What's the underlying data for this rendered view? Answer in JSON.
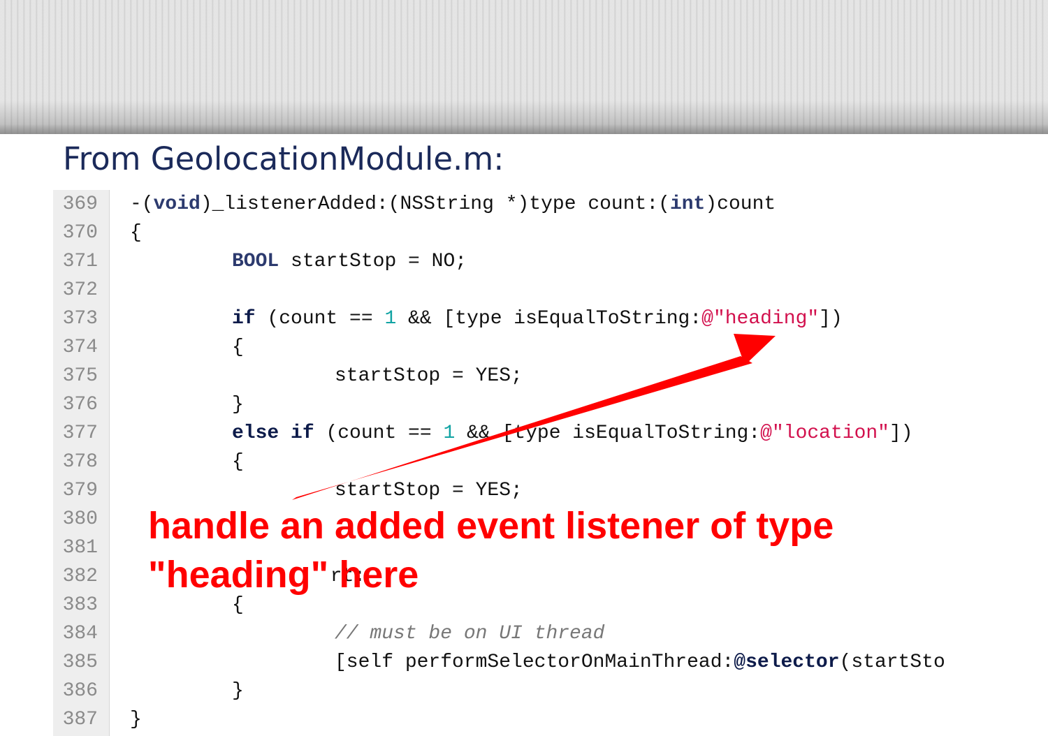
{
  "slide": {
    "title": "From GeolocationModule.m:",
    "annotation_line1": "handle an added event listener of type",
    "annotation_line2": "\"heading\" here",
    "annotation_color": "#ff0000",
    "title_color": "#1b2a5a"
  },
  "code": {
    "lines": [
      {
        "n": "369",
        "t": [
          "-(",
          "void",
          ")_listenerAdded:(NSString *)type count:(",
          "int",
          ")count"
        ]
      },
      {
        "n": "370",
        "t": [
          "{"
        ]
      },
      {
        "n": "371",
        "t": [
          "BOOL",
          " startStop = NO;"
        ]
      },
      {
        "n": "372",
        "t": [
          ""
        ]
      },
      {
        "n": "373",
        "t": [
          "if",
          " (count == ",
          "1",
          " && [type isEqualToString:",
          "@\"heading\"",
          "])"
        ]
      },
      {
        "n": "374",
        "t": [
          "{"
        ]
      },
      {
        "n": "375",
        "t": [
          "startStop = YES;"
        ]
      },
      {
        "n": "376",
        "t": [
          "}"
        ]
      },
      {
        "n": "377",
        "t": [
          "else if",
          " (count == ",
          "1",
          " && [type isEqualToString:",
          "@\"location\"",
          "])"
        ]
      },
      {
        "n": "378",
        "t": [
          "{"
        ]
      },
      {
        "n": "379",
        "t": [
          "startStop = YES;"
        ]
      },
      {
        "n": "380",
        "t": [
          ""
        ]
      },
      {
        "n": "381",
        "t": [
          ""
        ]
      },
      {
        "n": "382",
        "t": [
          " rt:"
        ]
      },
      {
        "n": "383",
        "t": [
          "{"
        ]
      },
      {
        "n": "384",
        "t": [
          "// must be on UI thread"
        ]
      },
      {
        "n": "385",
        "t": [
          "[self performSelectorOnMainThread:",
          "@selector",
          "(startSto"
        ]
      },
      {
        "n": "386",
        "t": [
          "}"
        ]
      },
      {
        "n": "387",
        "t": [
          "}"
        ]
      }
    ]
  }
}
